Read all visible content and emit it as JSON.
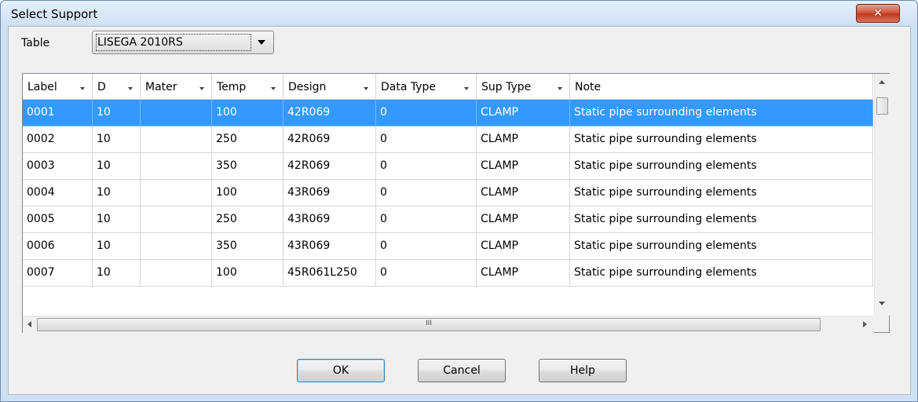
{
  "window": {
    "title": "Select Support",
    "close_glyph": "✕"
  },
  "table_select": {
    "label": "Table",
    "value": "LISEGA 2010RS"
  },
  "grid": {
    "columns": [
      "Label",
      "D",
      "Mater",
      "Temp",
      "Design",
      "Data Type",
      "Sup Type",
      "Note"
    ],
    "rows": [
      [
        "0001",
        "10",
        "",
        "100",
        "42R069",
        "0",
        "CLAMP",
        "Static pipe surrounding elements"
      ],
      [
        "0002",
        "10",
        "",
        "250",
        "42R069",
        "0",
        "CLAMP",
        "Static pipe surrounding elements"
      ],
      [
        "0003",
        "10",
        "",
        "350",
        "42R069",
        "0",
        "CLAMP",
        "Static pipe surrounding elements"
      ],
      [
        "0004",
        "10",
        "",
        "100",
        "43R069",
        "0",
        "CLAMP",
        "Static pipe surrounding elements"
      ],
      [
        "0005",
        "10",
        "",
        "250",
        "43R069",
        "0",
        "CLAMP",
        "Static pipe surrounding elements"
      ],
      [
        "0006",
        "10",
        "",
        "350",
        "43R069",
        "0",
        "CLAMP",
        "Static pipe surrounding elements"
      ],
      [
        "0007",
        "10",
        "",
        "100",
        "45R061L250",
        "0",
        "CLAMP",
        "Static pipe surrounding elements"
      ]
    ],
    "selected_row": 0,
    "hscroll_grip": "III"
  },
  "buttons": {
    "ok": "OK",
    "cancel": "Cancel",
    "help": "Help"
  },
  "colors": {
    "selection": "#3399ff",
    "close_button": "#c23a20"
  },
  "icons": {
    "close": "close-icon",
    "dropdown": "chevron-down-icon",
    "filter": "filter-dropdown-icon"
  }
}
